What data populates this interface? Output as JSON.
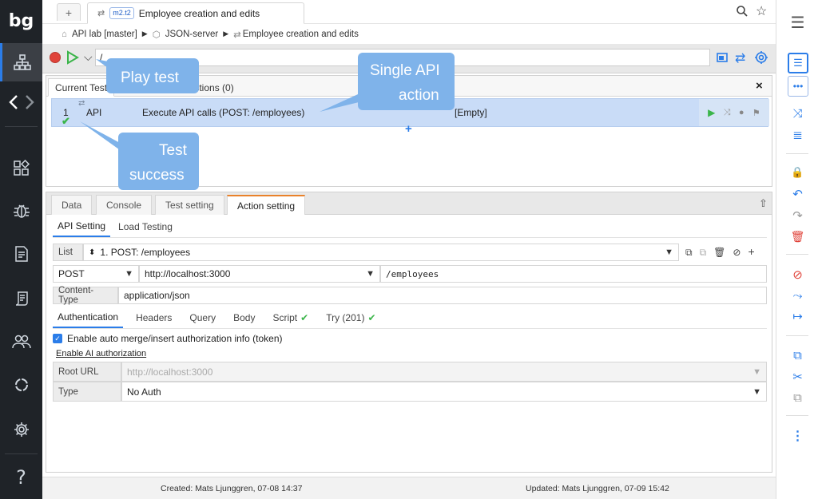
{
  "app": {
    "logo": "bg"
  },
  "tabs": {
    "new_tab": "+",
    "active_badge": "m2.t2",
    "active_title": "Employee creation and edits"
  },
  "breadcrumb": {
    "item1": "API lab [master]",
    "item2": "JSON-server",
    "item3": "Employee creation and edits"
  },
  "toolbar": {
    "url_value": "/"
  },
  "test_panel": {
    "tab_current": "Current Test",
    "tab_other": "d Actions (0)",
    "row": {
      "index": "1",
      "type": "API",
      "action": "Execute API calls (POST: /employees)",
      "value": "[Empty]"
    }
  },
  "bottom": {
    "tabs": [
      "Data",
      "Console",
      "Test setting",
      "Action setting"
    ],
    "subtabs": [
      "API Setting",
      "Load Testing"
    ],
    "list_label": "List",
    "list_value": "1. POST: /employees",
    "method": "POST",
    "base_url": "http://localhost:3000",
    "path": "/employees",
    "ct_label": "Content-Type",
    "ct_value": "application/json",
    "req_tabs": [
      "Authentication",
      "Headers",
      "Query",
      "Body",
      "Script",
      "Try (201)"
    ],
    "checkbox_label": "Enable auto merge/insert authorization info (token)",
    "ai_link": "Enable AI authorization",
    "root_label": "Root URL",
    "root_value": "http://localhost:3000",
    "type_label": "Type",
    "type_value": "No Auth"
  },
  "status": {
    "created": "Created: Mats Ljunggren, 07-08 14:37",
    "updated": "Updated: Mats Ljunggren, 07-09 15:42"
  },
  "callouts": {
    "play_line1": "Play  test",
    "single_line1": "Single API",
    "single_line2": "action",
    "success_line1": "Test",
    "success_line2": "success"
  },
  "colors": {
    "accent": "#2b7de9",
    "success": "#3bb54a",
    "danger": "#e0433a",
    "callout": "#7fb3ea",
    "active_tab_border": "#e9822b"
  }
}
